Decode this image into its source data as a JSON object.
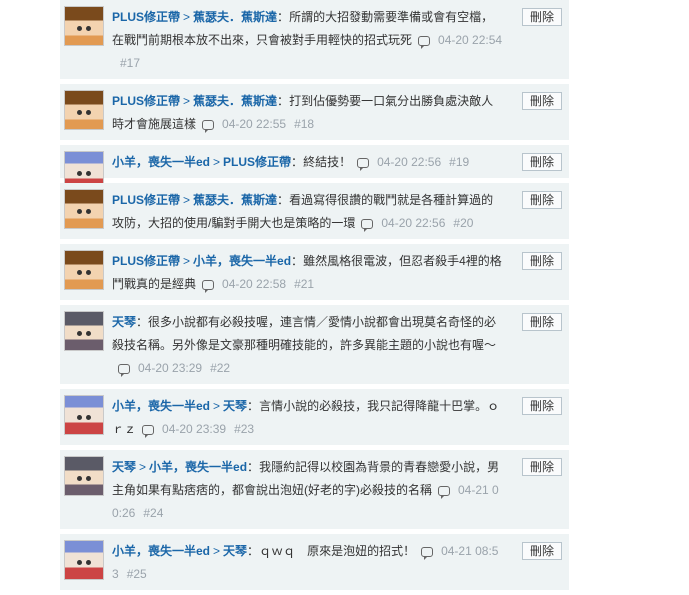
{
  "delete_label": "刪除",
  "replies": [
    {
      "avatar": "orange",
      "author": "PLUS修正帶",
      "target": "蕉瑟夫．蕉斯達",
      "text": "所謂的大招發動需要準備或會有空檔，在戰鬥前期根本放不出來，只會被對手用輕快的招式玩死",
      "time": "04-20 22:54",
      "floor": "#17"
    },
    {
      "avatar": "orange",
      "author": "PLUS修正帶",
      "target": "蕉瑟夫．蕉斯達",
      "text": "打到佔優勢要一口氣分出勝負處決敵人時才會施展這樣",
      "time": "04-20 22:55",
      "floor": "#18"
    },
    {
      "avatar": "blue",
      "author": "小羊，喪失一半ed",
      "target": "PLUS修正帶",
      "text": "終結技！",
      "time": "04-20 22:56",
      "floor": "#19"
    },
    {
      "avatar": "orange",
      "author": "PLUS修正帶",
      "target": "蕉瑟夫．蕉斯達",
      "text": "看過寫得很讚的戰鬥就是各種計算過的攻防，大招的使用/騙對手開大也是策略的一環",
      "time": "04-20 22:56",
      "floor": "#20"
    },
    {
      "avatar": "orange",
      "author": "PLUS修正帶",
      "target": "小羊，喪失一半ed",
      "text": "雖然風格很電波，但忍者殺手4裡的格鬥戰真的是經典",
      "time": "04-20 22:58",
      "floor": "#21"
    },
    {
      "avatar": "grey",
      "author": "天琴",
      "target": "",
      "text": "很多小說都有必殺技喔，連言情／愛情小說都會出現莫名奇怪的必殺技名稱。另外像是文豪那種明確技能的，許多異能主題的小說也有喔～",
      "time": "04-20 23:29",
      "floor": "#22"
    },
    {
      "avatar": "blue",
      "author": "小羊，喪失一半ed",
      "target": "天琴",
      "text": "言情小說的必殺技，我只記得降龍十巴掌。ｏｒｚ",
      "time": "04-20 23:39",
      "floor": "#23"
    },
    {
      "avatar": "grey",
      "author": "天琴",
      "target": "小羊，喪失一半ed",
      "text": "我隱約記得以校園為背景的青春戀愛小說，男主角如果有點痞痞的，都會說出泡妞(好老的字)必殺技的名稱",
      "time": "04-21 00:26",
      "floor": "#24"
    },
    {
      "avatar": "blue",
      "author": "小羊，喪失一半ed",
      "target": "天琴",
      "text": "ｑｗｑ　原來是泡妞的招式！",
      "time": "04-21 08:53",
      "floor": "#25"
    }
  ]
}
